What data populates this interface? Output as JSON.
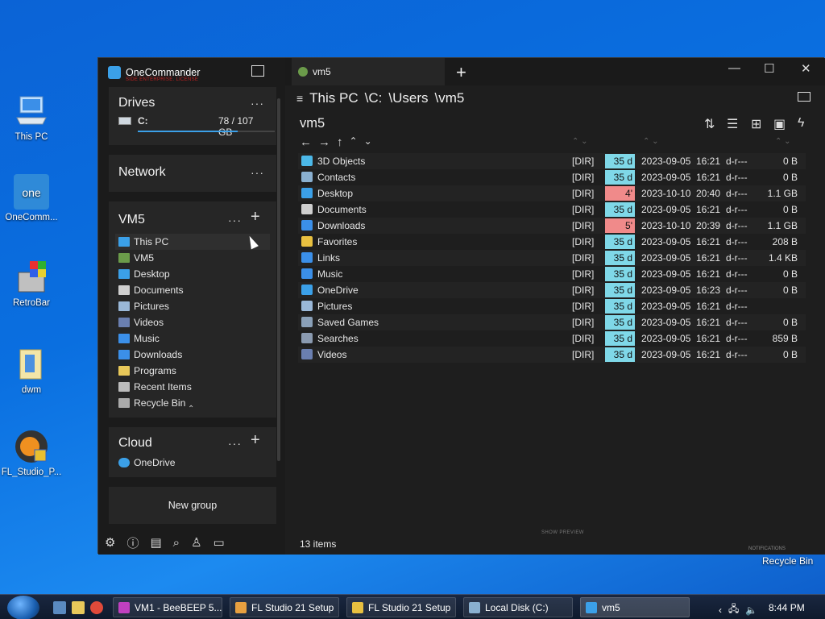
{
  "desktop": {
    "icons": [
      {
        "label": "This PC"
      },
      {
        "label": "OneComm..."
      },
      {
        "label": "RetroBar"
      },
      {
        "label": "dwm"
      },
      {
        "label": "FL_Studio_P..."
      }
    ],
    "recycle_bin_label": "Recycle Bin"
  },
  "app": {
    "title": "OneCommander",
    "subtitle": "SIDE ENTERPRISE. LICENSE",
    "tab_label": "vm5",
    "breadcrumb": [
      "This PC",
      "\\C:",
      "\\Users",
      "\\vm5"
    ],
    "folder_title": "vm5",
    "status_items": "13 items",
    "show_preview": "SHOW PREVIEW",
    "notifications": "NOTIFICATIONS"
  },
  "sidebar": {
    "drives": {
      "header": "Drives",
      "items": [
        {
          "label": "C:",
          "usage": "78 / 107 GB",
          "used_fraction": 0.73
        }
      ]
    },
    "network": {
      "header": "Network"
    },
    "vm5": {
      "header": "VM5",
      "items": [
        {
          "label": "This PC",
          "color": "#3ba0e8"
        },
        {
          "label": "VM5",
          "color": "#6b9b4a"
        },
        {
          "label": "Desktop",
          "color": "#3ba0e8"
        },
        {
          "label": "Documents",
          "color": "#cfcfcf"
        },
        {
          "label": "Pictures",
          "color": "#9ab8d8"
        },
        {
          "label": "Videos",
          "color": "#6a7fb0"
        },
        {
          "label": "Music",
          "color": "#3b8fe8"
        },
        {
          "label": "Downloads",
          "color": "#3b8fe8"
        },
        {
          "label": "Programs",
          "color": "#e8c85a"
        },
        {
          "label": "Recent Items",
          "color": "#bbbbbb"
        },
        {
          "label": "Recycle Bin",
          "color": "#aaaaaa"
        }
      ]
    },
    "cloud": {
      "header": "Cloud",
      "items": [
        {
          "label": "OneDrive",
          "color": "#3ba0e8"
        }
      ]
    },
    "new_group": "New group"
  },
  "files": {
    "rows": [
      {
        "name": "3D Objects",
        "type": "[DIR]",
        "age": "35 d",
        "age_color": "#7fd8e8",
        "date": "2023-09-05",
        "time": "16:21",
        "attr": "d-r---",
        "size": "0 B",
        "icon_color": "#4cb8e8"
      },
      {
        "name": "Contacts",
        "type": "[DIR]",
        "age": "35 d",
        "age_color": "#7fd8e8",
        "date": "2023-09-05",
        "time": "16:21",
        "attr": "d-r---",
        "size": "0 B",
        "icon_color": "#8ab0d0"
      },
      {
        "name": "Desktop",
        "type": "[DIR]",
        "age": "4'",
        "age_color": "#f08a8a",
        "date": "2023-10-10",
        "time": "20:40",
        "attr": "d-r---",
        "size": "1.1 GB",
        "icon_color": "#3ba0e8"
      },
      {
        "name": "Documents",
        "type": "[DIR]",
        "age": "35 d",
        "age_color": "#7fd8e8",
        "date": "2023-09-05",
        "time": "16:21",
        "attr": "d-r---",
        "size": "0 B",
        "icon_color": "#cfcfcf"
      },
      {
        "name": "Downloads",
        "type": "[DIR]",
        "age": "5'",
        "age_color": "#f08a8a",
        "date": "2023-10-10",
        "time": "20:39",
        "attr": "d-r---",
        "size": "1.1 GB",
        "icon_color": "#3b8fe8"
      },
      {
        "name": "Favorites",
        "type": "[DIR]",
        "age": "35 d",
        "age_color": "#7fd8e8",
        "date": "2023-09-05",
        "time": "16:21",
        "attr": "d-r---",
        "size": "208 B",
        "icon_color": "#e8c040"
      },
      {
        "name": "Links",
        "type": "[DIR]",
        "age": "35 d",
        "age_color": "#7fd8e8",
        "date": "2023-09-05",
        "time": "16:21",
        "attr": "d-r---",
        "size": "1.4 KB",
        "icon_color": "#3b8fe8"
      },
      {
        "name": "Music",
        "type": "[DIR]",
        "age": "35 d",
        "age_color": "#7fd8e8",
        "date": "2023-09-05",
        "time": "16:21",
        "attr": "d-r---",
        "size": "0 B",
        "icon_color": "#3b8fe8"
      },
      {
        "name": "OneDrive",
        "type": "[DIR]",
        "age": "35 d",
        "age_color": "#7fd8e8",
        "date": "2023-09-05",
        "time": "16:23",
        "attr": "d-r---",
        "size": "0 B",
        "icon_color": "#3ba0e8"
      },
      {
        "name": "Pictures",
        "type": "[DIR]",
        "age": "35 d",
        "age_color": "#7fd8e8",
        "date": "2023-09-05",
        "time": "16:21",
        "attr": "d-r---",
        "size": "",
        "icon_color": "#9ab8d8"
      },
      {
        "name": "Saved Games",
        "type": "[DIR]",
        "age": "35 d",
        "age_color": "#7fd8e8",
        "date": "2023-09-05",
        "time": "16:21",
        "attr": "d-r---",
        "size": "0 B",
        "icon_color": "#8aa0b8"
      },
      {
        "name": "Searches",
        "type": "[DIR]",
        "age": "35 d",
        "age_color": "#7fd8e8",
        "date": "2023-09-05",
        "time": "16:21",
        "attr": "d-r---",
        "size": "859 B",
        "icon_color": "#8a9ab0"
      },
      {
        "name": "Videos",
        "type": "[DIR]",
        "age": "35 d",
        "age_color": "#7fd8e8",
        "date": "2023-09-05",
        "time": "16:21",
        "attr": "d-r---",
        "size": "0 B",
        "icon_color": "#6a7fb0"
      }
    ]
  },
  "taskbar": {
    "tasks": [
      {
        "label": "VM1 - BeeBEEP 5....",
        "icon_color": "#c040c0"
      },
      {
        "label": "FL Studio 21 Setup",
        "icon_color": "#e8a040"
      },
      {
        "label": "FL Studio 21 Setup",
        "icon_color": "#e8c040"
      },
      {
        "label": "Local Disk (C:)",
        "icon_color": "#8ab0d0"
      },
      {
        "label": "vm5",
        "icon_color": "#3ba0e8"
      }
    ],
    "clock": "8:44 PM"
  }
}
